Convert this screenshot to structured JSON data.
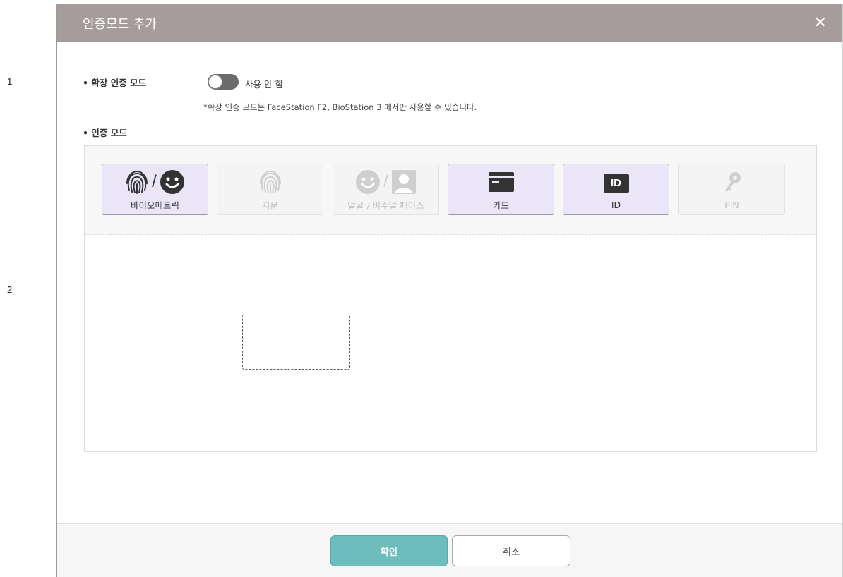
{
  "callouts": [
    "1",
    "2"
  ],
  "dialog": {
    "title": "인증모드 추가",
    "close_icon": "close-icon",
    "extended_mode": {
      "label": "• 확장 인증 모드",
      "toggle_state": "off",
      "toggle_text": "사용 안 함",
      "note": "*확장 인증 모드는 FaceStation F2, BioStation 3 에서만 사용할 수 있습니다."
    },
    "auth_mode": {
      "label": "• 인증 모드",
      "modes": [
        {
          "label": "바이오메트릭",
          "state": "active",
          "icons": [
            "fingerprint-icon",
            "face-icon"
          ]
        },
        {
          "label": "지문",
          "state": "disabled",
          "icons": [
            "fingerprint-icon"
          ]
        },
        {
          "label": "얼굴 / 비주얼 페이스",
          "state": "disabled",
          "icons": [
            "face-icon",
            "visual-face-icon"
          ]
        },
        {
          "label": "카드",
          "state": "active",
          "icons": [
            "card-icon"
          ]
        },
        {
          "label": "ID",
          "state": "active",
          "icons": [
            "id-icon"
          ],
          "icon_text": "ID"
        },
        {
          "label": "PIN",
          "state": "disabled",
          "icons": [
            "key-icon"
          ]
        }
      ],
      "separator": "/"
    },
    "footer": {
      "ok_label": "확인",
      "cancel_label": "취소"
    }
  },
  "colors": {
    "titlebar": "#a79c9c",
    "active_mode_bg": "#ebe6f7",
    "ok_button": "#6dbcbe"
  }
}
